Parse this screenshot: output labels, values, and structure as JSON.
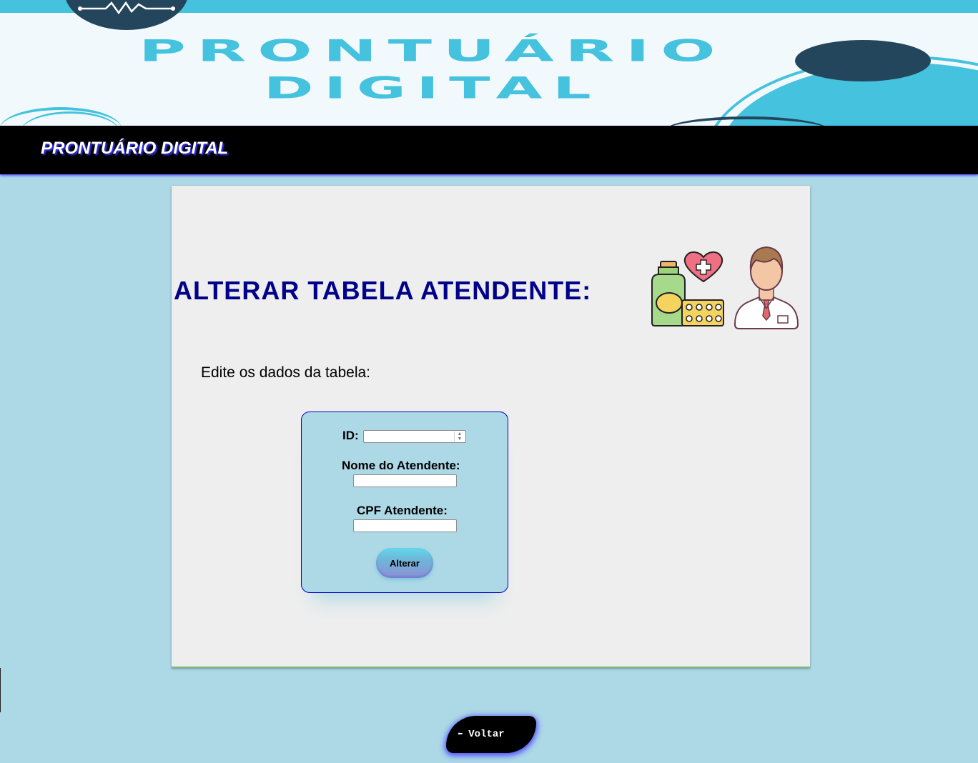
{
  "banner": {
    "title_line1": "PRONTUÁRIO",
    "title_line2": "DIGITAL"
  },
  "navbar": {
    "brand": "PRONTUÁRIO DIGITAL"
  },
  "main": {
    "heading": "ALTERAR TABELA ATENDENTE:",
    "subtitle": "Edite os dados da tabela:"
  },
  "form": {
    "id_label": "ID:",
    "id_value": "",
    "name_label": "Nome do Atendente:",
    "name_value": "",
    "cpf_label": "CPF Atendente:",
    "cpf_value": "",
    "submit_label": "Alterar"
  },
  "footer": {
    "back_label": "Voltar",
    "back_arrow": "⬅"
  },
  "colors": {
    "page_bg": "#add8e6",
    "banner_accent": "#45c2de",
    "banner_dark": "#24465c",
    "heading": "#00008b",
    "navbar_bg": "#000000"
  },
  "icons": [
    "heartbeat-logo-icon",
    "medicine-icon",
    "doctor-icon"
  ]
}
